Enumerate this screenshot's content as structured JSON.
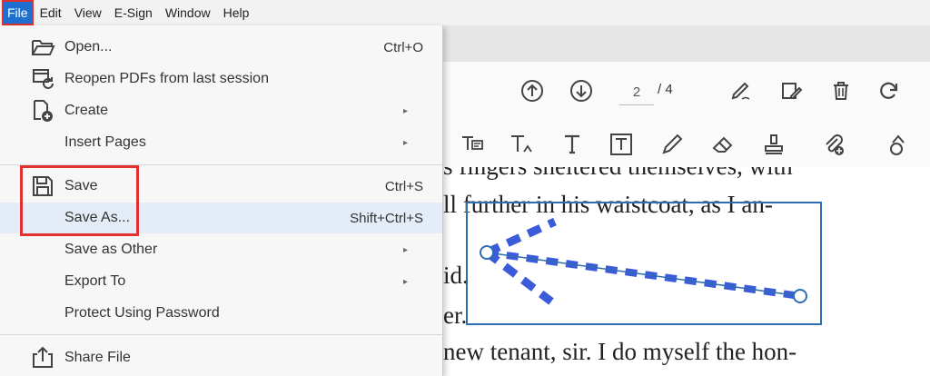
{
  "menubar": {
    "items": [
      "File",
      "Edit",
      "View",
      "E-Sign",
      "Window",
      "Help"
    ]
  },
  "toolbar": {
    "page_current": "2",
    "page_total": "/ 4"
  },
  "document": {
    "lines": [
      "s fingers sheltered themselves, with",
      "ll further in his waistcoat, as I an-",
      "id.",
      "er.",
      "new tenant, sir. I do myself the hon-"
    ]
  },
  "file_menu": {
    "items": [
      {
        "label": "Open...",
        "shortcut": "Ctrl+O",
        "icon": "folder-open-icon"
      },
      {
        "label": "Reopen PDFs from last session",
        "shortcut": "",
        "icon": "reopen-icon"
      },
      {
        "label": "Create",
        "shortcut": "",
        "icon": "create-pdf-icon",
        "submenu": true
      },
      {
        "label": "Insert Pages",
        "shortcut": "",
        "submenu": true
      },
      {
        "label": "Save",
        "shortcut": "Ctrl+S",
        "icon": "save-icon"
      },
      {
        "label": "Save As...",
        "shortcut": "Shift+Ctrl+S"
      },
      {
        "label": "Save as Other",
        "shortcut": "",
        "submenu": true
      },
      {
        "label": "Export To",
        "shortcut": "",
        "submenu": true
      },
      {
        "label": "Protect Using Password",
        "shortcut": ""
      },
      {
        "label": "Share File",
        "shortcut": "",
        "icon": "share-icon"
      }
    ]
  },
  "colors": {
    "accent": "#1f6fd0",
    "highlight_outline": "#e03030",
    "annotation": "#2f6db3",
    "arrow_fill": "#3b5bdb"
  }
}
